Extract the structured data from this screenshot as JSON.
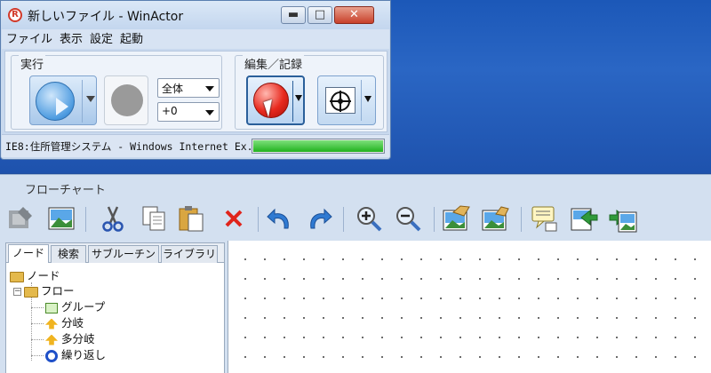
{
  "winactor": {
    "title": "新しいファイル - WinActor",
    "logo_glyph": "R",
    "controls": {
      "minimize": "▬",
      "maximize": "□",
      "close": "✕"
    },
    "menu": [
      "ファイル",
      "表示",
      "設定",
      "起動"
    ],
    "run_group": {
      "label": "実行",
      "scope_select": "全体",
      "offset_select": "+0"
    },
    "edit_group": {
      "label": "編集／記録"
    },
    "status_text": "IE8:住所管理システム - Windows Internet Ex...",
    "progress": 1.0,
    "accent_colors": {
      "record": "#e8291e",
      "play": "#4d9be0",
      "progress": "#21b21e",
      "desktop": "#1f57b6"
    }
  },
  "flowchart": {
    "title": "フローチャート",
    "toolbar_icons": [
      "edit-node-icon",
      "image-icon",
      "cut-icon",
      "copy-icon",
      "paste-icon",
      "delete-icon",
      "undo-icon",
      "redo-icon",
      "zoom-in-icon",
      "zoom-out-icon",
      "capture-image-icon",
      "capture-image-2-icon",
      "comment-icon",
      "export-image-icon",
      "import-image-icon"
    ],
    "tabs": [
      "ノード",
      "検索",
      "サブルーチン",
      "ライブラリ"
    ],
    "tree": {
      "root": "ノード",
      "folder": "フロー",
      "expander": "−",
      "items": [
        "グループ",
        "分岐",
        "多分岐",
        "繰り返し"
      ]
    }
  }
}
